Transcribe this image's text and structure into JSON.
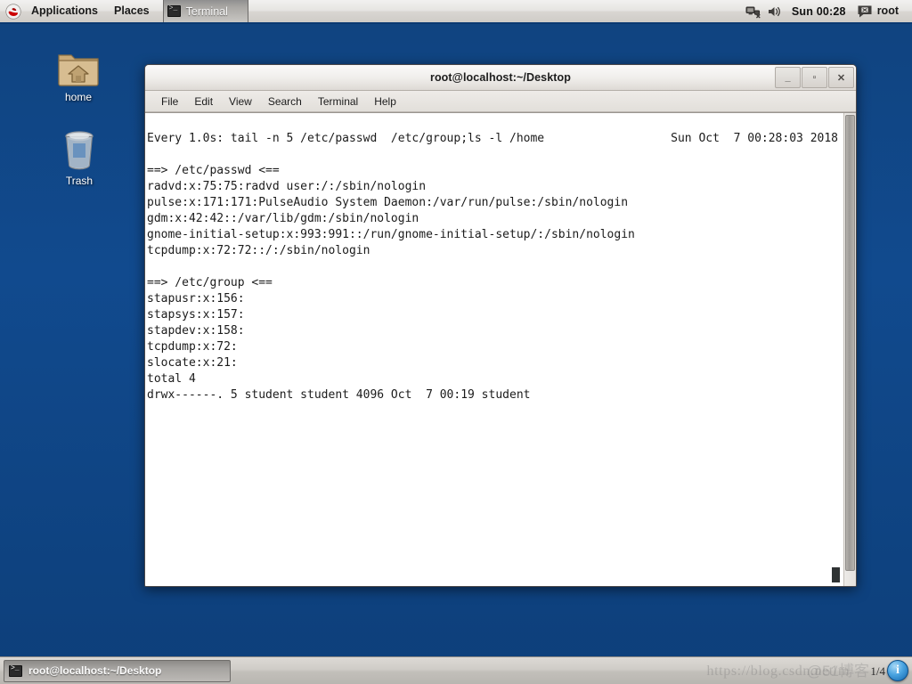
{
  "top_panel": {
    "logo": "redhat-logo",
    "menus": [
      {
        "label": "Applications",
        "name": "applications-menu"
      },
      {
        "label": "Places",
        "name": "places-menu"
      }
    ],
    "active_window_label": "Terminal",
    "clock": "Sun 00:28",
    "user": "root",
    "tray": {
      "network_icon": "network-disconnected-icon",
      "volume_icon": "volume-speaker-icon",
      "user_icon": "user-message-icon"
    }
  },
  "desktop": {
    "icons": [
      {
        "label": "home",
        "name": "desktop-icon-home"
      },
      {
        "label": "Trash",
        "name": "desktop-icon-trash"
      }
    ]
  },
  "terminal": {
    "title": "root@localhost:~/Desktop",
    "window_buttons": {
      "minimize": "_",
      "maximize": "▫",
      "close": "✕"
    },
    "menu": [
      "File",
      "Edit",
      "View",
      "Search",
      "Terminal",
      "Help"
    ],
    "header_left": "Every 1.0s: tail -n 5 /etc/passwd  /etc/group;ls -l /home",
    "header_right": "Sun Oct  7 00:28:03 2018",
    "output_lines": [
      "",
      "==> /etc/passwd <==",
      "radvd:x:75:75:radvd user:/:/sbin/nologin",
      "pulse:x:171:171:PulseAudio System Daemon:/var/run/pulse:/sbin/nologin",
      "gdm:x:42:42::/var/lib/gdm:/sbin/nologin",
      "gnome-initial-setup:x:993:991::/run/gnome-initial-setup/:/sbin/nologin",
      "tcpdump:x:72:72::/:/sbin/nologin",
      "",
      "==> /etc/group <==",
      "stapusr:x:156:",
      "stapsys:x:157:",
      "stapdev:x:158:",
      "tcpdump:x:72:",
      "slocate:x:21:",
      "total 4",
      "drwx------. 5 student student 4096 Oct  7 00:19 student"
    ]
  },
  "bottom_panel": {
    "task_button_label": "root@localhost:~/Desktop",
    "task_button_icon": "terminal-icon",
    "watermark": "https://blog.csdn.net/m",
    "watermark_cjk": "@51博客",
    "workspace": "1/4",
    "notification_icon": "info-icon",
    "notification_glyph": "i"
  },
  "colors": {
    "desktop_blue": "#114a8e",
    "panel_gray": "#cfccc7",
    "terminal_bg": "#ffffff",
    "terminal_fg": "#1b1b1b",
    "redhat_red": "#cc0000"
  }
}
